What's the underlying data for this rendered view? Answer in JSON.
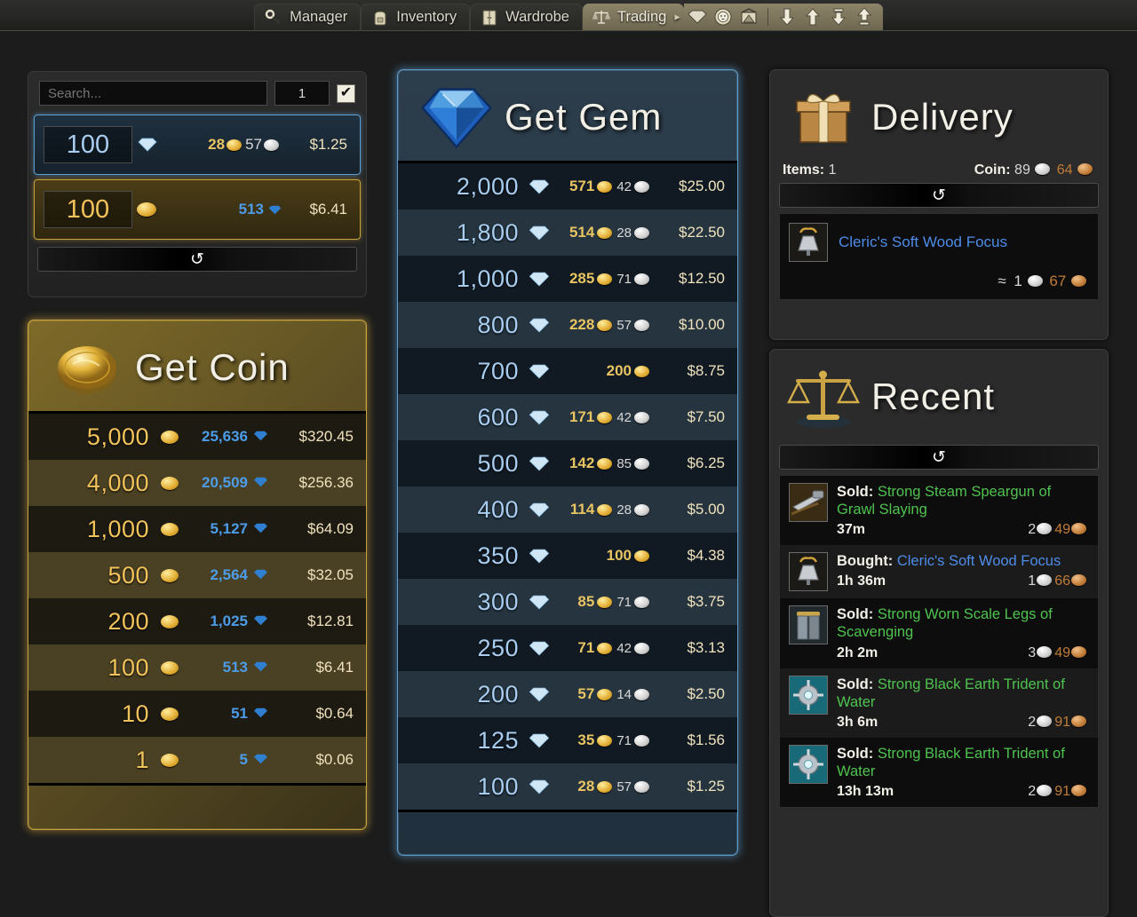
{
  "topnav": {
    "tabs": [
      {
        "label": "Manager",
        "icon": "key-icon",
        "active": false
      },
      {
        "label": "Inventory",
        "icon": "backpack-icon",
        "active": false
      },
      {
        "label": "Wardrobe",
        "icon": "wardrobe-icon",
        "active": false
      },
      {
        "label": "Trading",
        "icon": "scales-icon",
        "active": true
      }
    ],
    "tool_icons": [
      {
        "name": "gem-icon"
      },
      {
        "name": "lion-icon"
      },
      {
        "name": "trading-post-icon"
      }
    ],
    "arrow_icons": [
      {
        "name": "arrow-down-icon"
      },
      {
        "name": "arrow-up-icon"
      },
      {
        "name": "arrow-down-to-line-icon"
      },
      {
        "name": "arrow-up-from-line-icon"
      }
    ]
  },
  "search_panel": {
    "search_placeholder": "Search...",
    "quantity_value": "1",
    "checkbox_checked": true,
    "check_glyph": "✔",
    "refresh_glyph": "↺",
    "conversions": [
      {
        "kind": "gem",
        "amount": "100",
        "amount_icon": "gem-icon",
        "gold": "28",
        "silver": "57",
        "price": "$1.25"
      },
      {
        "kind": "coin",
        "amount": "100",
        "amount_icon": "gold-coin-icon",
        "gems": "513",
        "price": "$6.41"
      }
    ]
  },
  "get_coin": {
    "title": "Get Coin",
    "icon": "gold-coin-icon",
    "rows": [
      {
        "coin": "5,000",
        "gems": "25,636",
        "price": "$320.45"
      },
      {
        "coin": "4,000",
        "gems": "20,509",
        "price": "$256.36"
      },
      {
        "coin": "1,000",
        "gems": "5,127",
        "price": "$64.09"
      },
      {
        "coin": "500",
        "gems": "2,564",
        "price": "$32.05"
      },
      {
        "coin": "200",
        "gems": "1,025",
        "price": "$12.81"
      },
      {
        "coin": "100",
        "gems": "513",
        "price": "$6.41"
      },
      {
        "coin": "10",
        "gems": "51",
        "price": "$0.64"
      },
      {
        "coin": "1",
        "gems": "5",
        "price": "$0.06"
      }
    ]
  },
  "get_gem": {
    "title": "Get Gem",
    "icon": "blue-diamond-icon",
    "rows": [
      {
        "gems": "2,000",
        "gold": "571",
        "silver": "42",
        "price": "$25.00"
      },
      {
        "gems": "1,800",
        "gold": "514",
        "silver": "28",
        "price": "$22.50"
      },
      {
        "gems": "1,000",
        "gold": "285",
        "silver": "71",
        "price": "$12.50"
      },
      {
        "gems": "800",
        "gold": "228",
        "silver": "57",
        "price": "$10.00"
      },
      {
        "gems": "700",
        "gold": "200",
        "silver": "",
        "price": "$8.75"
      },
      {
        "gems": "600",
        "gold": "171",
        "silver": "42",
        "price": "$7.50"
      },
      {
        "gems": "500",
        "gold": "142",
        "silver": "85",
        "price": "$6.25"
      },
      {
        "gems": "400",
        "gold": "114",
        "silver": "28",
        "price": "$5.00"
      },
      {
        "gems": "350",
        "gold": "100",
        "silver": "",
        "price": "$4.38"
      },
      {
        "gems": "300",
        "gold": "85",
        "silver": "71",
        "price": "$3.75"
      },
      {
        "gems": "250",
        "gold": "71",
        "silver": "42",
        "price": "$3.13"
      },
      {
        "gems": "200",
        "gold": "57",
        "silver": "14",
        "price": "$2.50"
      },
      {
        "gems": "125",
        "gold": "35",
        "silver": "71",
        "price": "$1.56"
      },
      {
        "gems": "100",
        "gold": "28",
        "silver": "57",
        "price": "$1.25"
      }
    ]
  },
  "delivery": {
    "title": "Delivery",
    "icon": "gift-box-icon",
    "items_label": "Items:",
    "items_count": "1",
    "coin_label": "Coin:",
    "coin_silver": "89",
    "coin_copper": "64",
    "refresh_glyph": "↺",
    "item": {
      "name": "Cleric's Soft Wood Focus",
      "thumb": "focus-item-icon",
      "approx_symbol": "≈",
      "silver": "1",
      "copper": "67"
    }
  },
  "recent": {
    "title": "Recent",
    "icon": "scales-icon",
    "refresh_glyph": "↺",
    "entries": [
      {
        "action": "Sold:",
        "action_type": "sold",
        "item": "Strong Steam Speargun of Grawl Slaying",
        "thumb": "speargun-item-icon",
        "time": "37m",
        "silver": "2",
        "copper": "49"
      },
      {
        "action": "Bought:",
        "action_type": "bought",
        "item": "Cleric's Soft Wood Focus",
        "thumb": "focus-item-icon",
        "time": "1h 36m",
        "silver": "1",
        "copper": "66"
      },
      {
        "action": "Sold:",
        "action_type": "sold",
        "item": "Strong Worn Scale Legs of Scavenging",
        "thumb": "legs-item-icon",
        "time": "2h 2m",
        "silver": "3",
        "copper": "49"
      },
      {
        "action": "Sold:",
        "action_type": "sold",
        "item": "Strong Black Earth Trident of Water",
        "thumb": "trident-item-icon",
        "time": "3h 6m",
        "silver": "2",
        "copper": "91"
      },
      {
        "action": "Sold:",
        "action_type": "sold",
        "item": "Strong Black Earth Trident of Water",
        "thumb": "trident-item-icon",
        "time": "13h 13m",
        "silver": "2",
        "copper": "91"
      }
    ]
  },
  "colors": {
    "gem_blue": "#4d9ce8",
    "gold": "#e8c463",
    "silver": "#d8d8d8",
    "copper": "#c27c38",
    "sold_green": "#4fc34f",
    "bought_blue": "#4d8ce8",
    "price": "#f0e2bd"
  }
}
